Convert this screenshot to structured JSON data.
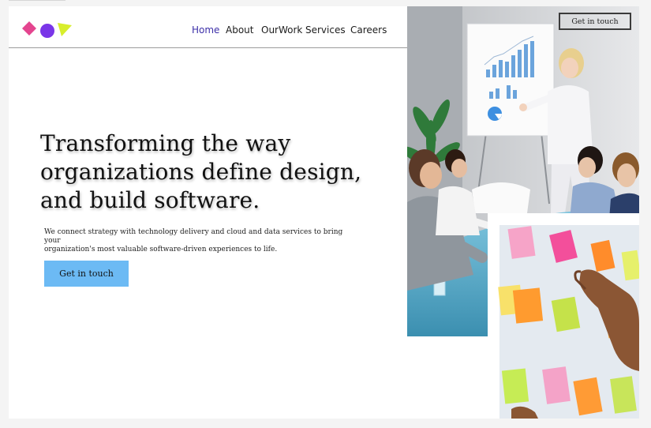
{
  "brand": {
    "logo_shapes": [
      "diamond",
      "circle",
      "triangle"
    ],
    "logo_colors": {
      "diamond": "#e4458f",
      "circle": "#7a36e8",
      "triangle": "#d8ee2c"
    }
  },
  "nav": {
    "items": [
      {
        "label": "Home",
        "active": true
      },
      {
        "label": "About",
        "active": false
      },
      {
        "label": "OurWork",
        "active": false
      },
      {
        "label": "Services",
        "active": false
      },
      {
        "label": "Careers",
        "active": false
      }
    ],
    "active_color": "#3c2fa8"
  },
  "header_cta": {
    "label": "Get in touch"
  },
  "hero": {
    "headline_lines": [
      "Transforming the way",
      "organizations define design,",
      "and build software."
    ],
    "subtext_lines": [
      "We connect strategy with technology delivery and cloud  and data services to bring your",
      "organization's most valuable software-driven experiences to life."
    ],
    "cta_label": "Get in touch",
    "cta_color": "#6cbaf4"
  },
  "images": {
    "meeting_photo": "presenter-at-flipchart-meeting-photo",
    "sticky_notes_photo": "hand-arranging-sticky-notes-photo"
  }
}
